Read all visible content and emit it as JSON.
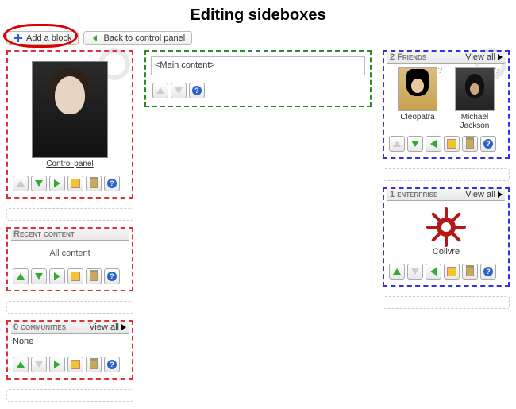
{
  "title": "Editing sideboxes",
  "topbar": {
    "add_block": "Add a block",
    "back": "Back to control panel"
  },
  "main": {
    "placeholder": "<Main content>"
  },
  "left": {
    "profile": {
      "caption": "Control panel"
    },
    "recent": {
      "title": "Recent content",
      "body": "All content"
    },
    "communities": {
      "count": "0",
      "word": "communities",
      "viewall": "View all",
      "body": "None"
    }
  },
  "right": {
    "friends": {
      "count": "2",
      "word": "Friends",
      "viewall": "View all",
      "items": [
        {
          "name": "Cleopatra"
        },
        {
          "name": "Michael Jackson"
        }
      ]
    },
    "enterprise": {
      "count": "1",
      "word": "enterprise",
      "viewall": "View all",
      "item": {
        "name": "Colivre"
      }
    }
  },
  "help_glyph": "?"
}
